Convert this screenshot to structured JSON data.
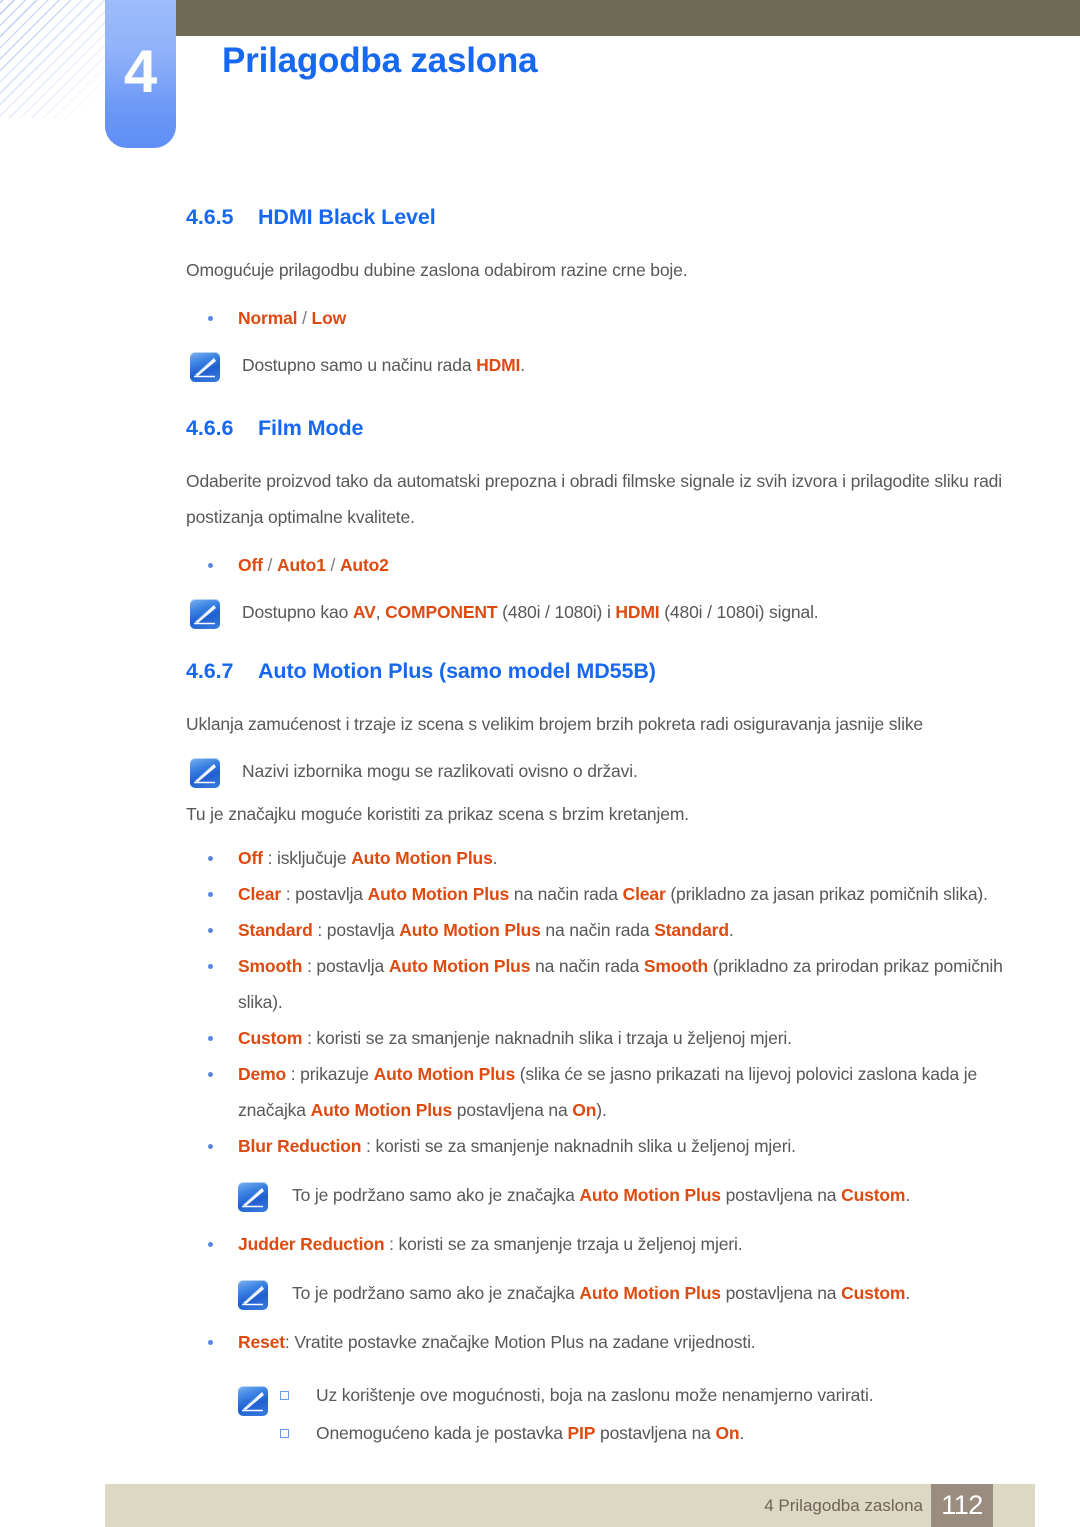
{
  "header": {
    "chapter_number": "4",
    "chapter_title": "Prilagodba zaslona",
    "olive_color": "#6e6b55",
    "badge_color": "#6d99f6",
    "title_color": "#1768f0"
  },
  "colors": {
    "heading_blue": "#1768f0",
    "highlight_orange": "#dd4b10",
    "body_gray": "#58585a",
    "bullet_blue": "#5b86e0",
    "footer_bar": "#ddd8c4",
    "footer_page_box": "#9a8d80"
  },
  "sections": [
    {
      "number": "4.6.5",
      "title": "HDMI Black Level",
      "body": "Omogućuje prilagodbu dubine zaslona odabirom razine crne boje.",
      "option_bullet": {
        "opt1": "Normal",
        "sep": "/",
        "opt2": "Low"
      },
      "note": {
        "pre": "Dostupno samo u načinu rada ",
        "hl": "HDMI",
        "post": "."
      }
    },
    {
      "number": "4.6.6",
      "title": "Film Mode",
      "body": "Odaberite proizvod tako da automatski prepozna i obradi filmske signale iz svih izvora i prilagodite sliku radi postizanja optimalne kvalitete.",
      "option_bullet": {
        "opt1": "Off",
        "sep1": "/",
        "opt2": "Auto1",
        "sep2": "/",
        "opt3": "Auto2"
      },
      "note": {
        "p1": "Dostupno kao ",
        "hl1": "AV",
        "p2": ", ",
        "hl2": "COMPONENT",
        "p3": " (480i / 1080i) i ",
        "hl3": "HDMI",
        "p4": "  (480i / 1080i) signal."
      }
    },
    {
      "number": "4.6.7",
      "title": "Auto Motion Plus (samo model MD55B)",
      "body": "Uklanja zamućenost i trzaje iz scena s velikim brojem brzih pokreta radi osiguravanja jasnije slike",
      "note": "Nazivi izbornika mogu se razlikovati ovisno o državi.",
      "body2": "Tu je značajku moguće koristiti za prikaz scena s brzim kretanjem."
    }
  ],
  "amp_bullets": {
    "off": {
      "term": "Off",
      "p1": " : isključuje ",
      "hl1": "Auto Motion Plus",
      "p2": "."
    },
    "clear": {
      "term": "Clear",
      "p1": " : postavlja ",
      "hl1": "Auto Motion Plus",
      "p2": " na način rada ",
      "hl2": "Clear",
      "p3": " (prikladno za jasan prikaz pomičnih slika)."
    },
    "standard": {
      "term": "Standard",
      "p1": " : postavlja ",
      "hl1": "Auto Motion Plus",
      "p2": " na način rada ",
      "hl2": "Standard",
      "p3": "."
    },
    "smooth": {
      "term": "Smooth",
      "p1": " : postavlja ",
      "hl1": "Auto Motion Plus",
      "p2": " na način rada ",
      "hl2": "Smooth",
      "p3": " (prikladno za prirodan prikaz pomičnih slika)."
    },
    "custom": {
      "term": "Custom",
      "p1": " : koristi se za smanjenje naknadnih slika i trzaja u željenoj mjeri."
    },
    "demo": {
      "term": "Demo",
      "p1": " : prikazuje ",
      "hl1": "Auto Motion Plus",
      "p2": " (slika će se jasno prikazati na lijevoj polovici zaslona kada je značajka ",
      "hl2": "Auto Motion Plus",
      "p3": " postavljena na ",
      "hl3": "On",
      "p4": ")."
    },
    "blur_reduction": {
      "term": "Blur Reduction",
      "p1": " : koristi se za smanjenje naknadnih slika u željenoj mjeri."
    },
    "judder_reduction": {
      "term": "Judder Reduction",
      "p1": " : koristi se za smanjenje trzaja u željenoj mjeri."
    },
    "reset": {
      "term": "Reset",
      "p1": ": Vratite postavke značajke Motion Plus na zadane vrijednosti."
    }
  },
  "notes": {
    "custom_support_1": {
      "p1": "To je podržano samo ako je značajka ",
      "hl1": "Auto Motion Plus",
      "p2": " postavljena na ",
      "hl2": "Custom",
      "p3": "."
    },
    "custom_support_2": {
      "p1": "To je podržano samo ako je značajka ",
      "hl1": "Auto Motion Plus",
      "p2": " postavljena na ",
      "hl2": "Custom",
      "p3": "."
    },
    "reset_sub_1": "Uz korištenje ove mogućnosti, boja na zaslonu može nenamjerno varirati.",
    "reset_sub_2": {
      "p1": "Onemogućeno kada je postavka ",
      "hl1": "PIP",
      "p2": " postavljena na ",
      "hl2": "On",
      "p3": "."
    }
  },
  "footer": {
    "text": "4 Prilagodba zaslona",
    "page": "112"
  }
}
